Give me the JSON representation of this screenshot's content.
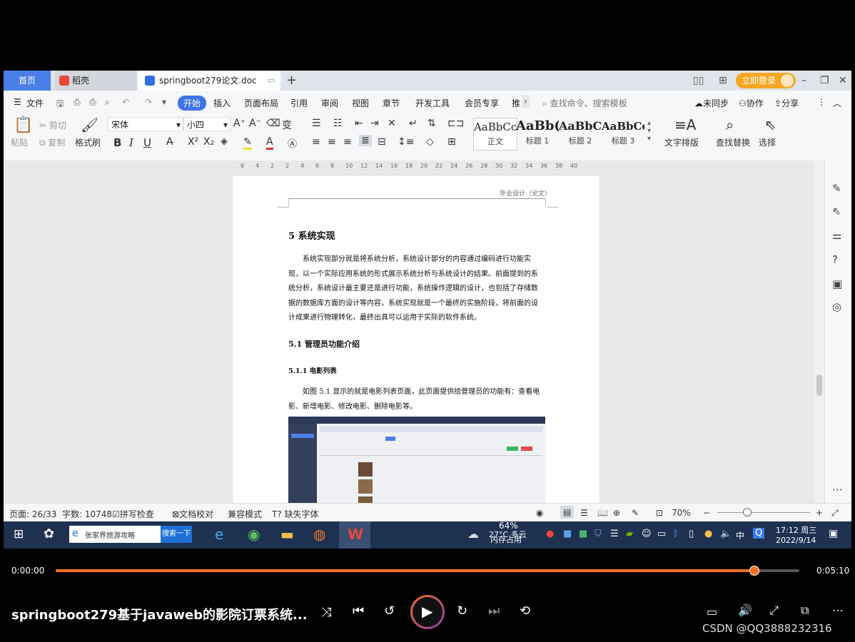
{
  "tabs": {
    "home": "首页",
    "daoke": "稻壳",
    "doc": "springboot279论文.doc",
    "new_tab": "+"
  },
  "top_right": {
    "login": "立即登录"
  },
  "menu": {
    "file": "文件",
    "items": [
      "开始",
      "插入",
      "页面布局",
      "引用",
      "审阅",
      "视图",
      "章节",
      "开发工具",
      "会员专享",
      "推"
    ],
    "search_placeholder": "查找命令、搜索模板",
    "unsynced": "未同步",
    "collab": "协作",
    "share": "分享"
  },
  "ribbon": {
    "paste": "粘贴",
    "cut": "剪切",
    "copy": "复制",
    "format_painter": "格式刷",
    "font": "宋体",
    "size": "小四",
    "styles": [
      {
        "preview": "AaBbCcI",
        "label": "正文"
      },
      {
        "preview": "AaBb(",
        "label": "标题 1"
      },
      {
        "preview": "AaBbC",
        "label": "标题 2"
      },
      {
        "preview": "AaBbCcl",
        "label": "标题 3"
      }
    ],
    "text_layout": "文字排版",
    "find_replace": "查找替换",
    "select": "选择"
  },
  "ruler": [
    "6",
    "4",
    "2",
    "2",
    "4",
    "6",
    "8",
    "10",
    "12",
    "14",
    "16",
    "18",
    "20",
    "22",
    "24",
    "26",
    "28",
    "30",
    "32",
    "34",
    "36",
    "38",
    "40"
  ],
  "document": {
    "header": "毕业设计（论文）",
    "h1": "5  系统实现",
    "para1": [
      "系统实现部分就是将系统分析，系统设计部分的内容通过编码进行功能实",
      "现，以一个实际应用系统的形式展示系统分析与系统设计的结果。前面提到的系",
      "统分析，系统设计最主要还是进行功能，系统操作逻辑的设计，也包括了存储数",
      "据的数据库方面的设计等内容，系统实现就是一个最终的实施阶段，将前面的设",
      "计成果进行物理转化，最终出具可以运用于实际的软件系统。"
    ],
    "h2": "5.1  管理员功能介绍",
    "h3": "5.1.1  电影列表",
    "para2": [
      "如图 5.1 显示的就是电影列表页面，此页面提供给管理员的功能有：查看电",
      "影、新增电影、修改电影、删除电影等。"
    ]
  },
  "status": {
    "page": "页面: 26/33",
    "words": "字数: 10748",
    "spellcheck": "拼写检查",
    "proof": "文档校对",
    "compat": "兼容模式",
    "missing_font": "缺失字体",
    "zoom": "70%"
  },
  "taskbar": {
    "search_text": "张家界旅游攻略",
    "search_btn": "搜索一下",
    "weather": "27°C 多云",
    "mem_pct": "64%",
    "mem_label": "内存占用",
    "ime": "中",
    "time": "17:12 周三",
    "date": "2022/9/14"
  },
  "video": {
    "current": "0:00:00",
    "total": "0:05:10",
    "progress": 0.94,
    "title": "springboot279基于javaweb的影院订票系统...",
    "watermark": "CSDN @QQ3888232316"
  },
  "colors": {
    "accent": "#3f74e8",
    "progress": "#f37021",
    "taskbar": "#1e3150"
  }
}
